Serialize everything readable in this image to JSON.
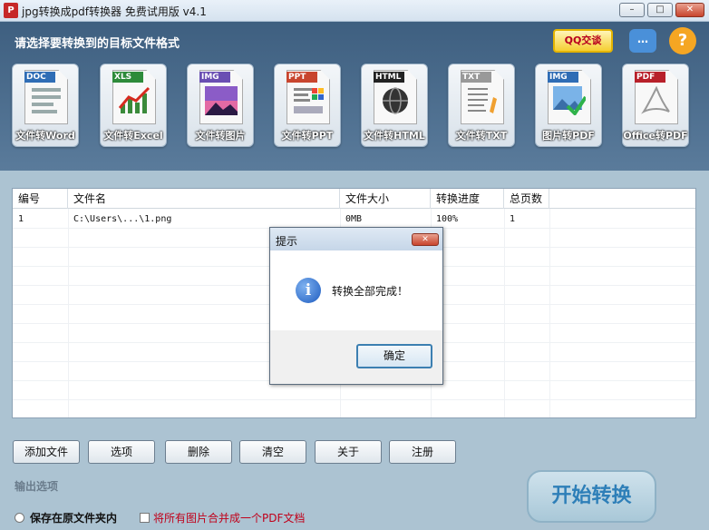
{
  "window": {
    "title": "jpg转换成pdf转换器 免费试用版 v4.1",
    "app_icon_text": "P",
    "minimize": "–",
    "maximize": "□",
    "close": "✕"
  },
  "header": {
    "label": "请选择要转换到的目标文件格式",
    "qq_label": "QQ交谈",
    "chat_icon": "…",
    "help_icon": "?"
  },
  "formats": [
    {
      "tag": "DOC",
      "label": "文件转Word",
      "color": "#2f6db5"
    },
    {
      "tag": "XLS",
      "label": "文件转Excel",
      "color": "#2e8b3a"
    },
    {
      "tag": "IMG",
      "label": "文件转图片",
      "color": "#6a4fb3"
    },
    {
      "tag": "PPT",
      "label": "文件转PPT",
      "color": "#c8452e"
    },
    {
      "tag": "HTML",
      "label": "文件转HTML",
      "color": "#222222"
    },
    {
      "tag": "TXT",
      "label": "文件转TXT",
      "color": "#999999"
    },
    {
      "tag": "IMG",
      "label": "图片转PDF",
      "color": "#2f6db5"
    },
    {
      "tag": "PDF",
      "label": "Office转PDF",
      "color": "#b8202a"
    }
  ],
  "table": {
    "columns": [
      "编号",
      "文件名",
      "文件大小",
      "转换进度",
      "总页数"
    ],
    "rows": [
      {
        "index": "1",
        "filename": "C:\\Users\\...\\1.png",
        "size": "0MB",
        "progress": "100%",
        "pages": "1"
      }
    ]
  },
  "buttons": {
    "add": "添加文件",
    "options": "选项",
    "delete": "删除",
    "clear": "清空",
    "about": "关于",
    "register": "注册",
    "start": "开始转换"
  },
  "output": {
    "section_label": "输出选项",
    "save_original": "保存在原文件夹内",
    "merge_pdf": "将所有图片合并成一个PDF文档"
  },
  "dialog": {
    "title": "提示",
    "message": "转换全部完成！",
    "ok": "确定",
    "info_glyph": "i",
    "close": "✕"
  }
}
